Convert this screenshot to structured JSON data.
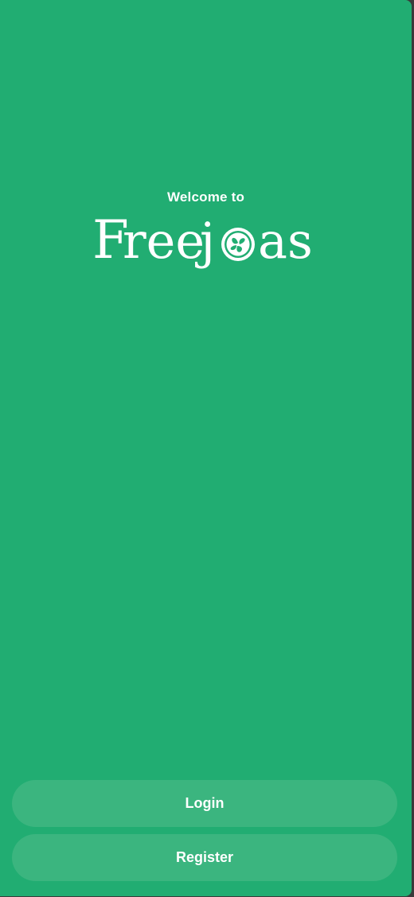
{
  "welcome_text": "Welcome to",
  "logo": {
    "text": "Freejoas",
    "icon": "fruit-slice-icon"
  },
  "buttons": {
    "login_label": "Login",
    "register_label": "Register"
  },
  "colors": {
    "background": "#21ad72",
    "button": "#3bb57f",
    "text": "#ffffff"
  }
}
